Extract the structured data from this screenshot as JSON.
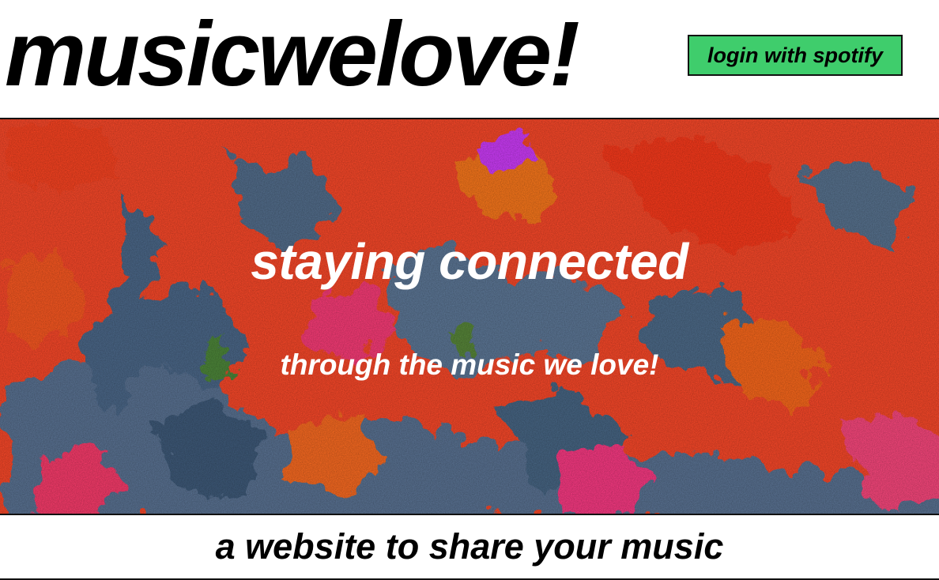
{
  "header": {
    "logo_text": "musicwelove!",
    "login_button_label": "login with spotify"
  },
  "hero": {
    "title": "staying connected",
    "subtitle": "through the music we love!",
    "background_description_colors": [
      "#ff4a2a",
      "#ff6a1f",
      "#4f6e9a",
      "#6a7f8f",
      "#ff2d7a",
      "#c638ff"
    ]
  },
  "footer": {
    "tagline": "a website to share your music"
  },
  "colors": {
    "login_button_bg": "#3fcd6c",
    "hero_text": "#ffffff",
    "text_primary": "#000000",
    "border": "#111111"
  }
}
